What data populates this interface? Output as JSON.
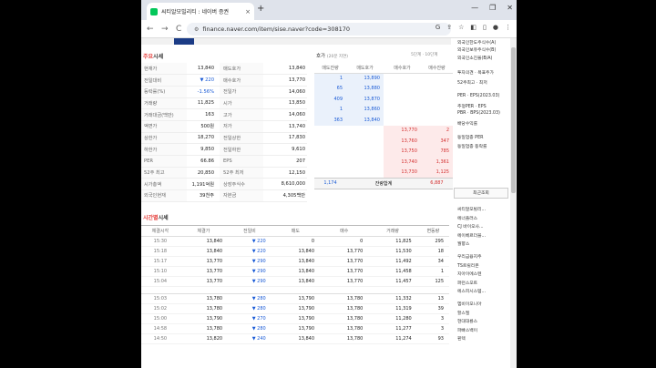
{
  "browser": {
    "tab_title": "씨티알모빌리티 : 네이버 증권",
    "tab_close": "×",
    "new_tab": "+",
    "url": "finance.naver.com/item/sise.naver?code=308170",
    "back": "←",
    "forward": "→",
    "reload": "C",
    "min": "—",
    "max": "❐",
    "close": "✕"
  },
  "summary": {
    "title_main": "주요",
    "title_rest": "시세",
    "rows": [
      [
        "현재가",
        "13,840",
        "매도호가",
        "13,840"
      ],
      [
        "전일대비",
        "▼ 220",
        "매수호가",
        "13,770"
      ],
      [
        "등락률(%)",
        "-1.56%",
        "전일가",
        "14,060"
      ],
      [
        "거래량",
        "11,825",
        "시가",
        "13,850"
      ],
      [
        "거래대금(백만)",
        "163",
        "고가",
        "14,060"
      ],
      [
        "액면가",
        "500원",
        "저가",
        "13,740"
      ],
      [
        "상한가",
        "18,270",
        "전일상한",
        "17,830"
      ],
      [
        "하한가",
        "9,850",
        "전일하한",
        "9,610"
      ],
      [
        "PER",
        "66.86",
        "EPS",
        "207"
      ],
      [
        "52주 최고",
        "20,850",
        "52주 최저",
        "12,150"
      ],
      [
        "시가총액",
        "1,191억원",
        "상장주식수",
        "8,610,000"
      ],
      [
        "외국인현재",
        "39천주",
        "자본금",
        "4,305백만"
      ]
    ]
  },
  "orderbook": {
    "title": "호가",
    "subtitle": "(20분 지연)",
    "toggle": "5단계 · 10단계",
    "headers": [
      "매도잔량",
      "매도호가",
      "매수호가",
      "매수잔량"
    ],
    "asks": [
      [
        "1",
        "13,890"
      ],
      [
        "65",
        "13,880"
      ],
      [
        "409",
        "13,870"
      ],
      [
        "1",
        "13,860"
      ],
      [
        "363",
        "13,840"
      ]
    ],
    "bids": [
      [
        "13,770",
        "2"
      ],
      [
        "13,760",
        "347"
      ],
      [
        "13,750",
        "785"
      ],
      [
        "13,740",
        "1,361"
      ],
      [
        "13,730",
        "1,125"
      ]
    ],
    "total_ask": "1,174",
    "total_label": "잔량합계",
    "total_bid": "6,887"
  },
  "time_sise": {
    "title_main": "시간별",
    "title_rest": "시세",
    "headers": [
      "체결시각",
      "체결가",
      "전일비",
      "매도",
      "매수",
      "거래량",
      "변동량"
    ],
    "group1": [
      [
        "15:30",
        "13,840",
        "▼ 220",
        "0",
        "0",
        "11,825",
        "295"
      ],
      [
        "15:18",
        "13,840",
        "▼ 220",
        "13,840",
        "13,770",
        "11,530",
        "18"
      ],
      [
        "15:17",
        "13,770",
        "▼ 290",
        "13,840",
        "13,770",
        "11,492",
        "34"
      ],
      [
        "15:10",
        "13,770",
        "▼ 290",
        "13,840",
        "13,770",
        "11,458",
        "1"
      ],
      [
        "15:04",
        "13,770",
        "▼ 290",
        "13,840",
        "13,770",
        "11,457",
        "125"
      ]
    ],
    "group2": [
      [
        "15:03",
        "13,780",
        "▼ 280",
        "13,790",
        "13,780",
        "11,332",
        "13"
      ],
      [
        "15:02",
        "13,780",
        "▼ 280",
        "13,790",
        "13,780",
        "11,319",
        "39"
      ],
      [
        "15:00",
        "13,790",
        "▼ 270",
        "13,790",
        "13,780",
        "11,280",
        "3"
      ],
      [
        "14:58",
        "13,780",
        "▼ 280",
        "13,790",
        "13,780",
        "11,277",
        "3"
      ],
      [
        "14:50",
        "13,820",
        "▼ 240",
        "13,840",
        "13,780",
        "11,274",
        "93"
      ]
    ]
  },
  "sidebar": {
    "top_lines": [
      "외국인한도주식수(A)",
      "외국인보유주식수(B)",
      "외국인소진율(B/A)",
      "투자의견 · 목표주가",
      "52주최고 · 최저",
      "PER · EPS(2023.03)",
      "추정PER · EPS",
      "PBR · BPS(2023.03)",
      "배당수익률",
      "동일업종 PER",
      "동일업종 등락률"
    ],
    "recent_title": "최근조회",
    "recent": [
      "씨티알모빌리...",
      "에너플러스",
      "CJ 바이오사...",
      "에이베르더블...",
      "월향스",
      "우리금융지주",
      "TS트릴리온",
      "지아이에스텐",
      "퍼런스모트",
      "에스피시스템...",
      "엠비이오니아",
      "할스필",
      "현대대룡스",
      "파빠스백이",
      "핀텍"
    ]
  }
}
